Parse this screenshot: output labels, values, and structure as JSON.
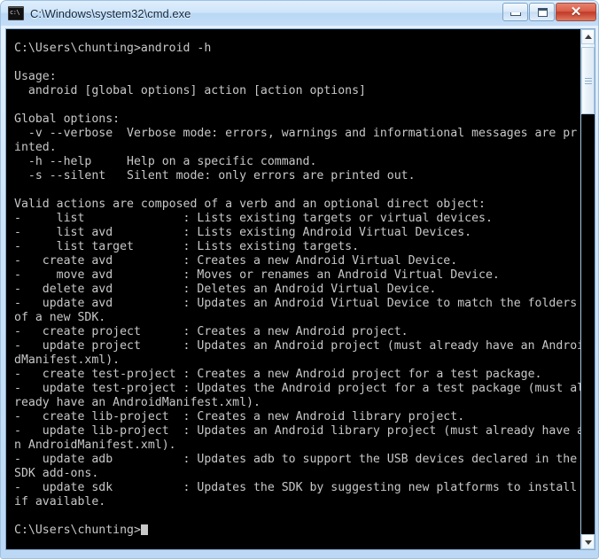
{
  "window": {
    "title": "C:\\Windows\\system32\\cmd.exe",
    "icon": "cmd-console-icon",
    "buttons": {
      "minimize_label": "─",
      "maximize_label": "□",
      "close_label": "✕"
    },
    "colors": {
      "console_background": "#000000",
      "console_foreground": "#c8c8c8",
      "titlebar": "#bcd8f4",
      "close_button": "#c03a28",
      "frame_border": "#9dc2e6"
    }
  },
  "scrollbar": {
    "up_arrow": "scroll-up-arrow",
    "down_arrow": "scroll-down-arrow",
    "thumb": "scroll-thumb"
  },
  "console": {
    "prompt_current": "C:\\Users\\chunting>",
    "cursor": "block-cursor",
    "text": "C:\\Users\\chunting>android -h\n\nUsage:\n  android [global options] action [action options]\n\nGlobal options:\n  -v --verbose  Verbose mode: errors, warnings and informational messages are pr\ninted.\n  -h --help     Help on a specific command.\n  -s --silent   Silent mode: only errors are printed out.\n\nValid actions are composed of a verb and an optional direct object:\n-     list              : Lists existing targets or virtual devices.\n-     list avd          : Lists existing Android Virtual Devices.\n-     list target       : Lists existing targets.\n-   create avd          : Creates a new Android Virtual Device.\n-     move avd          : Moves or renames an Android Virtual Device.\n-   delete avd          : Deletes an Android Virtual Device.\n-   update avd          : Updates an Android Virtual Device to match the folders\nof a new SDK.\n-   create project      : Creates a new Android project.\n-   update project      : Updates an Android project (must already have an Androi\ndManifest.xml).\n-   create test-project : Creates a new Android project for a test package.\n-   update test-project : Updates the Android project for a test package (must al\nready have an AndroidManifest.xml).\n-   create lib-project  : Creates a new Android library project.\n-   update lib-project  : Updates an Android library project (must already have a\nn AndroidManifest.xml).\n-   update adb          : Updates adb to support the USB devices declared in the\nSDK add-ons.\n-   update sdk          : Updates the SDK by suggesting new platforms to install\nif available.\n\n"
  }
}
